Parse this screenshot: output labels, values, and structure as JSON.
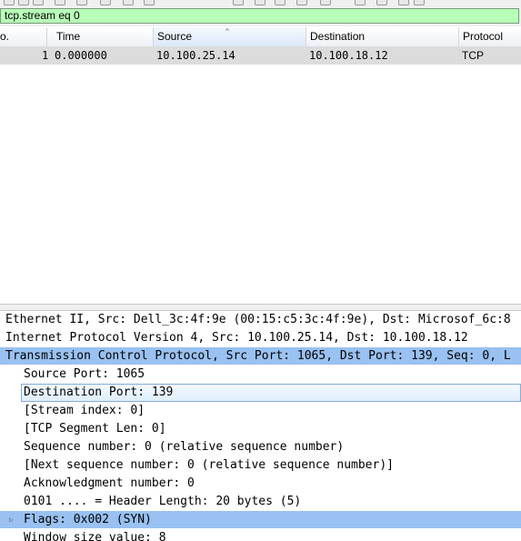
{
  "filter": {
    "value": "tcp.stream eq 0"
  },
  "packet_list": {
    "columns": [
      "o.",
      "Time",
      "Source",
      "Destination",
      "Protocol"
    ],
    "sort_indicator": "^",
    "rows": [
      {
        "no": "1",
        "time": "0.000000",
        "source": "10.100.25.14",
        "destination": "10.100.18.12",
        "protocol": "TCP"
      }
    ]
  },
  "details": {
    "ethernet": "Ethernet II, Src: Dell_3c:4f:9e (00:15:c5:3c:4f:9e), Dst: Microsof_6c:8",
    "ip": "Internet Protocol Version 4, Src: 10.100.25.14, Dst: 10.100.18.12",
    "tcp": "Transmission Control Protocol, Src Port: 1065, Dst Port: 139, Seq: 0, L",
    "fields": [
      "Source Port: 1065",
      "Destination Port: 139",
      "[Stream index: 0]",
      "[TCP Segment Len: 0]",
      "Sequence number: 0    (relative sequence number)",
      "[Next sequence number: 0    (relative sequence number)]",
      "Acknowledgment number: 0",
      "0101 .... = Header Length: 20 bytes (5)",
      "Flags: 0x002 (SYN)",
      "Window size value: 8"
    ],
    "expander_glyph": "▷"
  },
  "colors": {
    "filter_valid": "#b8ffb8",
    "selection": "#99c1f1",
    "row_selected": "#dcdcdc"
  }
}
